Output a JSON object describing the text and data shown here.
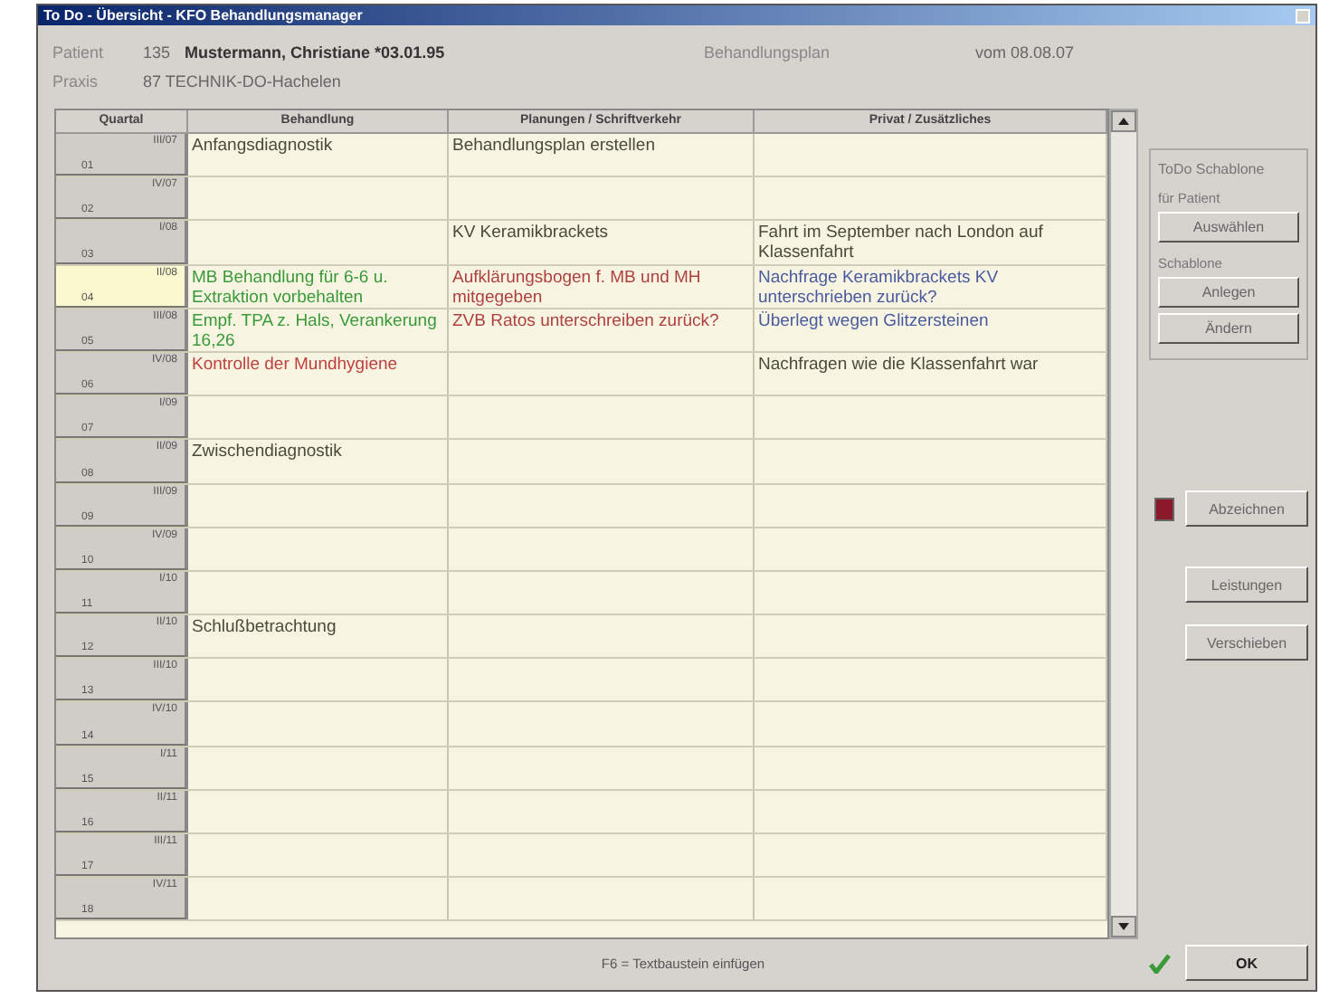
{
  "window": {
    "title": "To Do - Übersicht - KFO Behandlungsmanager"
  },
  "header": {
    "patient_label": "Patient",
    "patient_number": "135",
    "patient_name": "Mustermann, Christiane *03.01.95",
    "plan_label": "Behandlungsplan",
    "plan_date": "vom 08.08.07",
    "practice_label": "Praxis",
    "practice_name": "87 TECHNIK-DO-Hachelen"
  },
  "table": {
    "columns": [
      "Quartal",
      "Behandlung",
      "Planungen / Schriftverkehr",
      "Privat / Zusätzliches"
    ],
    "rows": [
      {
        "selected": false,
        "cells": [
          {
            "period": "III/07",
            "number": "01"
          },
          {
            "text": "Anfangsdiagnostik",
            "color": "#4a4a3a"
          },
          {
            "text": "Behandlungsplan erstellen",
            "color": "#4a4a3a"
          },
          null
        ]
      },
      {
        "selected": false,
        "cells": [
          {
            "period": "IV/07",
            "number": "02"
          },
          null,
          null,
          null
        ]
      },
      {
        "selected": false,
        "cells": [
          {
            "period": "I/08",
            "number": "03"
          },
          null,
          {
            "text": "KV Keramikbrackets",
            "color": "#4a4a3a"
          },
          {
            "text": "Fahrt im September nach London auf Klassenfahrt",
            "color": "#4a4a3a"
          }
        ]
      },
      {
        "selected": true,
        "cells": [
          {
            "period": "II/08",
            "number": "04"
          },
          {
            "text": "MB Behandlung für 6-6 u. Extraktion vorbehalten",
            "color": "#3a9a3a"
          },
          {
            "text": "Aufklärungsbogen f. MB und MH mitgegeben",
            "color": "#b04040"
          },
          {
            "text": "Nachfrage Keramikbrackets KV unterschrieben zurück?",
            "color": "#4a5aa0"
          }
        ]
      },
      {
        "selected": false,
        "cells": [
          {
            "period": "III/08",
            "number": "05"
          },
          {
            "text": "Empf. TPA z. Hals, Verankerung 16,26",
            "color": "#3a9a3a"
          },
          {
            "text": "ZVB Ratos unterschreiben zurück?",
            "color": "#b04040"
          },
          {
            "text": "Überlegt wegen Glitzersteinen",
            "color": "#4a5aa0"
          }
        ]
      },
      {
        "selected": false,
        "cells": [
          {
            "period": "IV/08",
            "number": "06"
          },
          {
            "text": "Kontrolle der Mundhygiene",
            "color": "#c04040"
          },
          null,
          {
            "text": "Nachfragen wie die Klassenfahrt war",
            "color": "#4a4a3a"
          }
        ]
      },
      {
        "selected": false,
        "cells": [
          {
            "period": "I/09",
            "number": "07"
          },
          null,
          null,
          null
        ]
      },
      {
        "selected": false,
        "cells": [
          {
            "period": "II/09",
            "number": "08"
          },
          {
            "text": "Zwischendiagnostik",
            "color": "#4a4a3a"
          },
          null,
          null
        ]
      },
      {
        "selected": false,
        "cells": [
          {
            "period": "III/09",
            "number": "09"
          },
          null,
          null,
          null
        ]
      },
      {
        "selected": false,
        "cells": [
          {
            "period": "IV/09",
            "number": "10"
          },
          null,
          null,
          null
        ]
      },
      {
        "selected": false,
        "cells": [
          {
            "period": "I/10",
            "number": "11"
          },
          null,
          null,
          null
        ]
      },
      {
        "selected": false,
        "cells": [
          {
            "period": "II/10",
            "number": "12"
          },
          {
            "text": "Schlußbetrachtung",
            "color": "#4a4a3a"
          },
          null,
          null
        ]
      },
      {
        "selected": false,
        "cells": [
          {
            "period": "III/10",
            "number": "13"
          },
          null,
          null,
          null
        ]
      },
      {
        "selected": false,
        "cells": [
          {
            "period": "IV/10",
            "number": "14"
          },
          null,
          null,
          null
        ]
      },
      {
        "selected": false,
        "cells": [
          {
            "period": "I/11",
            "number": "15"
          },
          null,
          null,
          null
        ]
      },
      {
        "selected": false,
        "cells": [
          {
            "period": "II/11",
            "number": "16"
          },
          null,
          null,
          null
        ]
      },
      {
        "selected": false,
        "cells": [
          {
            "period": "III/11",
            "number": "17"
          },
          null,
          null,
          null
        ]
      },
      {
        "selected": false,
        "cells": [
          {
            "period": "IV/11",
            "number": "18"
          },
          null,
          null,
          null
        ]
      }
    ]
  },
  "template_panel": {
    "title": "ToDo Schablone",
    "patient_label": "für Patient",
    "select_button": "Auswählen",
    "template_label": "Schablone",
    "create_button": "Anlegen",
    "edit_button": "Ändern"
  },
  "sign": {
    "checked": true,
    "button": "Abzeichnen"
  },
  "buttons": [
    "Leistungen",
    "Verschieben"
  ],
  "ok_button": "OK",
  "status_bar": "F6 = Textbaustein einfügen"
}
